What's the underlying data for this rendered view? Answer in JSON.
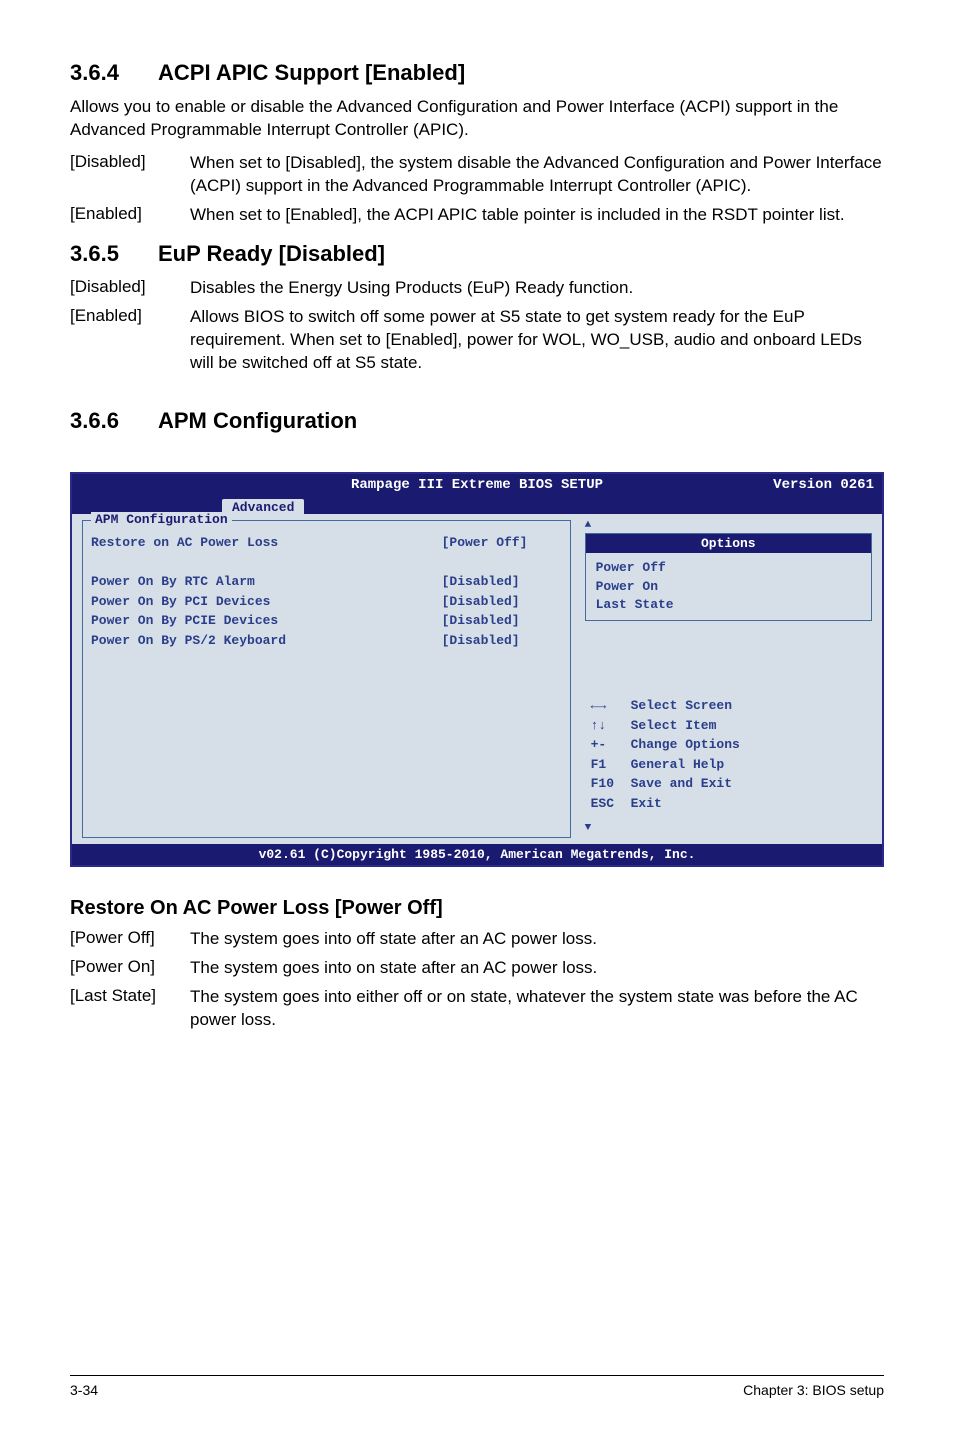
{
  "sec364": {
    "num": "3.6.4",
    "title": "ACPI APIC Support [Enabled]",
    "intro": "Allows you to enable or disable the Advanced Configuration and Power Interface (ACPI) support in the Advanced Programmable Interrupt Controller (APIC).",
    "rows": [
      {
        "term": "[Disabled]",
        "desc": "When set to [Disabled], the system disable the Advanced Configuration and Power Interface (ACPI) support in the Advanced Programmable Interrupt Controller (APIC)."
      },
      {
        "term": "[Enabled]",
        "desc": "When set to [Enabled], the ACPI APIC table pointer is included in the RSDT pointer list."
      }
    ]
  },
  "sec365": {
    "num": "3.6.5",
    "title": "EuP Ready [Disabled]",
    "rows": [
      {
        "term": "[Disabled]",
        "desc": "Disables the Energy Using Products (EuP) Ready function."
      },
      {
        "term": "[Enabled]",
        "desc": "Allows BIOS to switch off some power at S5 state to get system ready for the EuP requirement. When set to [Enabled], power for WOL, WO_USB, audio and onboard LEDs will be switched off at S5 state."
      }
    ]
  },
  "sec366": {
    "num": "3.6.6",
    "title": "APM Configuration"
  },
  "bios": {
    "headerCenter": "Rampage III Extreme BIOS SETUP",
    "headerRight": "Version 0261",
    "tab": "Advanced",
    "leftTitle": "APM Configuration",
    "settings": [
      {
        "label": "Restore on AC Power Loss",
        "value": "[Power Off]"
      },
      {
        "label": "",
        "value": ""
      },
      {
        "label": "Power On By RTC Alarm",
        "value": "[Disabled]"
      },
      {
        "label": "Power On By PCI Devices",
        "value": "[Disabled]"
      },
      {
        "label": "Power On By PCIE Devices",
        "value": "[Disabled]"
      },
      {
        "label": "Power On By PS/2 Keyboard",
        "value": "[Disabled]"
      }
    ],
    "optionsHeader": "Options",
    "options": [
      "Power Off",
      "Power On",
      "Last State"
    ],
    "help": [
      {
        "key": "←→",
        "text": "Select Screen"
      },
      {
        "key": "↑↓",
        "text": "Select Item"
      },
      {
        "key": "+-",
        "text": "Change Options"
      },
      {
        "key": "F1",
        "text": "General Help"
      },
      {
        "key": "F10",
        "text": "Save and Exit"
      },
      {
        "key": "ESC",
        "text": "Exit"
      }
    ],
    "footer": "v02.61 (C)Copyright 1985-2010, American Megatrends, Inc."
  },
  "restore": {
    "heading": "Restore On AC Power Loss [Power Off]",
    "rows": [
      {
        "term": "[Power Off]",
        "desc": "The system goes into off state after an AC power loss."
      },
      {
        "term": "[Power On]",
        "desc": "The system goes into on state after an AC power loss."
      },
      {
        "term": "[Last State]",
        "desc": "The system goes into either off or on state, whatever the system state was before the AC power loss."
      }
    ]
  },
  "footer": {
    "left": "3-34",
    "right": "Chapter 3: BIOS setup"
  }
}
